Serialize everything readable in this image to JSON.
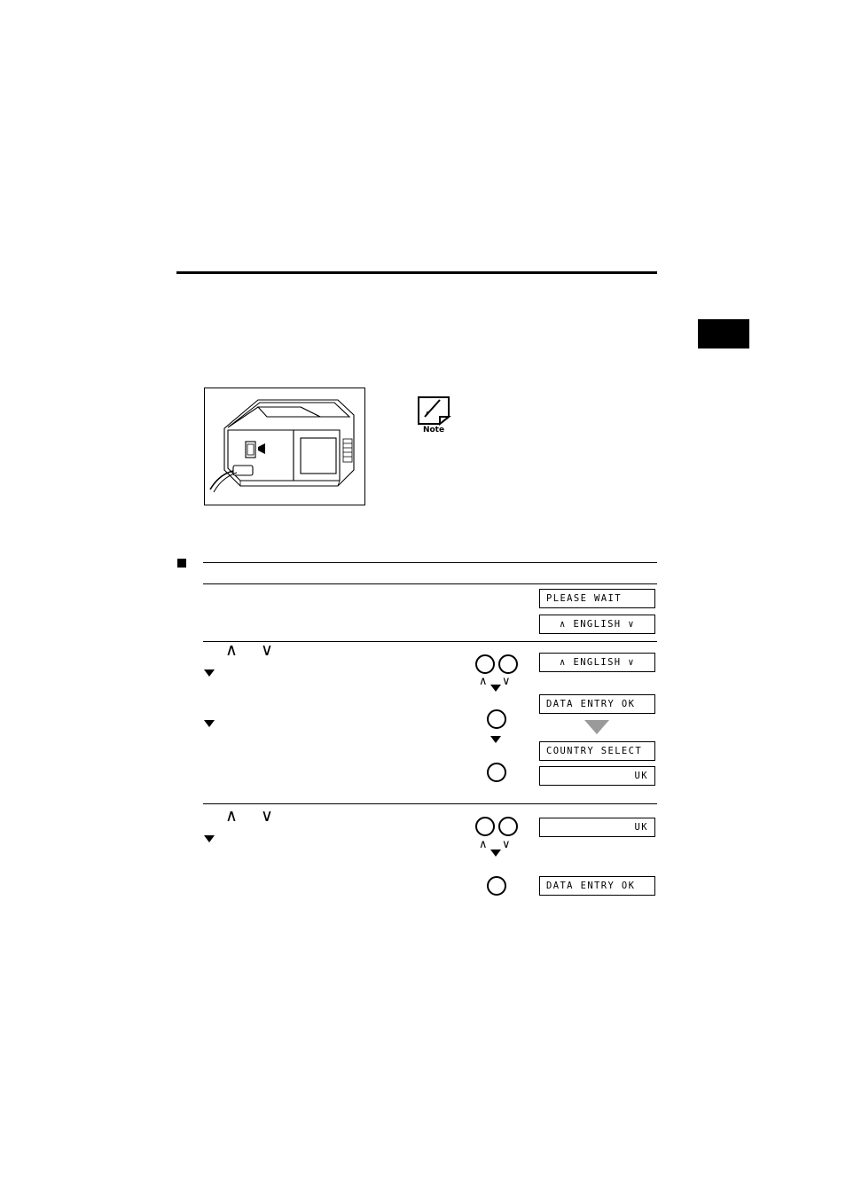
{
  "page": {
    "tab_marker": "",
    "note_icon_label": "Note"
  },
  "illustration": {
    "name": "fax-machine-rear-power-cord",
    "caption": ""
  },
  "displays": {
    "please_wait": "PLEASE WAIT",
    "english_1": "∧ ENGLISH ∨",
    "english_2": "∧ ENGLISH ∨",
    "data_entry_ok_1": "DATA ENTRY OK",
    "country_select": "COUNTRY SELECT",
    "uk_1": "UK",
    "uk_2": "UK",
    "data_entry_ok_2": "DATA ENTRY OK"
  },
  "buttons": {
    "up_glyph": "∧",
    "down_glyph": "∨",
    "set_glyph": ""
  },
  "instructions": {
    "step_chevrons": [
      "∧",
      "∨"
    ]
  }
}
